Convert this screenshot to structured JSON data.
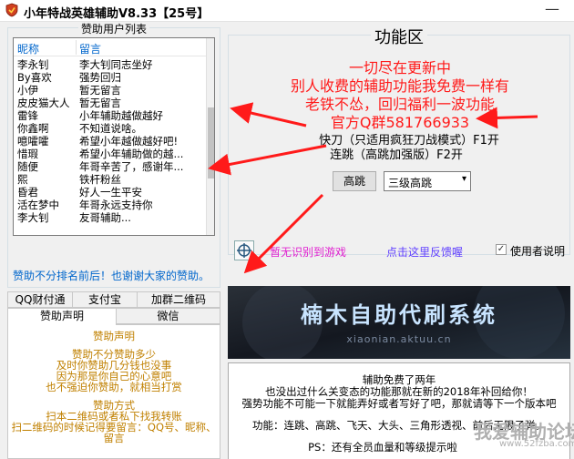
{
  "window": {
    "title": "小年特战英雄辅助V8.33【25号】",
    "minimize_glyph": "—"
  },
  "sponsors": {
    "group_title": "赞助用户列表",
    "col_name": "昵称",
    "col_message": "留言",
    "rows": [
      {
        "name": "李永钊",
        "message": "李大钊同志坐好"
      },
      {
        "name": "By喜欢",
        "message": "强势回归"
      },
      {
        "name": "小伊",
        "message": "暂无留言"
      },
      {
        "name": "皮皮猫大人",
        "message": "暂无留言"
      },
      {
        "name": "雷锋",
        "message": "小年辅助越做越好"
      },
      {
        "name": "你鑫啊",
        "message": "不知道说啥。"
      },
      {
        "name": "噫嚯嚯",
        "message": "希望小年越做越好吧!"
      },
      {
        "name": "惜瑕",
        "message": "希望小年辅助做的越..."
      },
      {
        "name": "随便",
        "message": "年哥辛苦了，感谢年..."
      },
      {
        "name": "熙",
        "message": "铁杆粉丝"
      },
      {
        "name": "昏君",
        "message": "好人一生平安"
      },
      {
        "name": "活在梦中",
        "message": "年哥永远支持你"
      },
      {
        "name": "李大钊",
        "message": "友哥辅助..."
      }
    ],
    "note": "赞助不分排名前后！也谢谢大家的赞助。"
  },
  "tabs": {
    "row1": [
      "QQ财付通",
      "支付宝",
      "加群二维码"
    ],
    "row2": [
      "赞助声明",
      "微信"
    ],
    "panel_lines": [
      "赞助声明",
      "",
      "赞助不分赞助多少",
      "及时你赞助几分钱也没事",
      "因为那是你自己的心意吧",
      "也不强迫你赞助，就相当打赏",
      "",
      "赞助方式",
      "扫本二维码或者私下找我转账",
      "扫二维码的时候记得要留言：QQ号、昵称、",
      "留言"
    ]
  },
  "functions": {
    "title": "功能区",
    "red_lines": [
      "一切尽在更新中",
      "别人收费的辅助功能我免费一样有",
      "老铁不怂，回归福利一波功能",
      "官方Q群581766933"
    ],
    "hotkey_lines": [
      "快刀（只适用疯狂刀战模式）F1开",
      "连跳（高跳加强版）F2开"
    ],
    "jump_button": "高跳",
    "level_select": "三级高跳",
    "select_arrow": "▾",
    "not_detected_link": "暂无识别到游戏",
    "feedback_link": "点击这里反馈喔",
    "help_checkbox_mark": "✓",
    "help_checkbox_label": "使用者说明"
  },
  "banner": {
    "title": "楠木自助代刷系统",
    "subtitle": "xiaonian.aktuu.cn"
  },
  "info": {
    "lines": [
      "辅助免费了两年",
      "也没出过什么关变态的功能那就在新的2018年补回给你！",
      "强势功能不可能一下就能弄好或者写好了吧，那就请等下一个版本吧",
      "功能：连跳、高跳、飞天、大头、三角形透视、前后无限子弹。",
      "PS：还有全员血量和等级提示啦"
    ]
  },
  "watermark": {
    "text": "我爱辅助论坛",
    "url": "www.52fzba.com"
  },
  "colors": {
    "red_text": "#ff1a1a",
    "accent_blue": "#0066cc",
    "tab_text_gold": "#c08000",
    "link_magenta": "#e020d0",
    "link_feedback": "#6040ff",
    "arrow_red": "#ff1a1a"
  }
}
